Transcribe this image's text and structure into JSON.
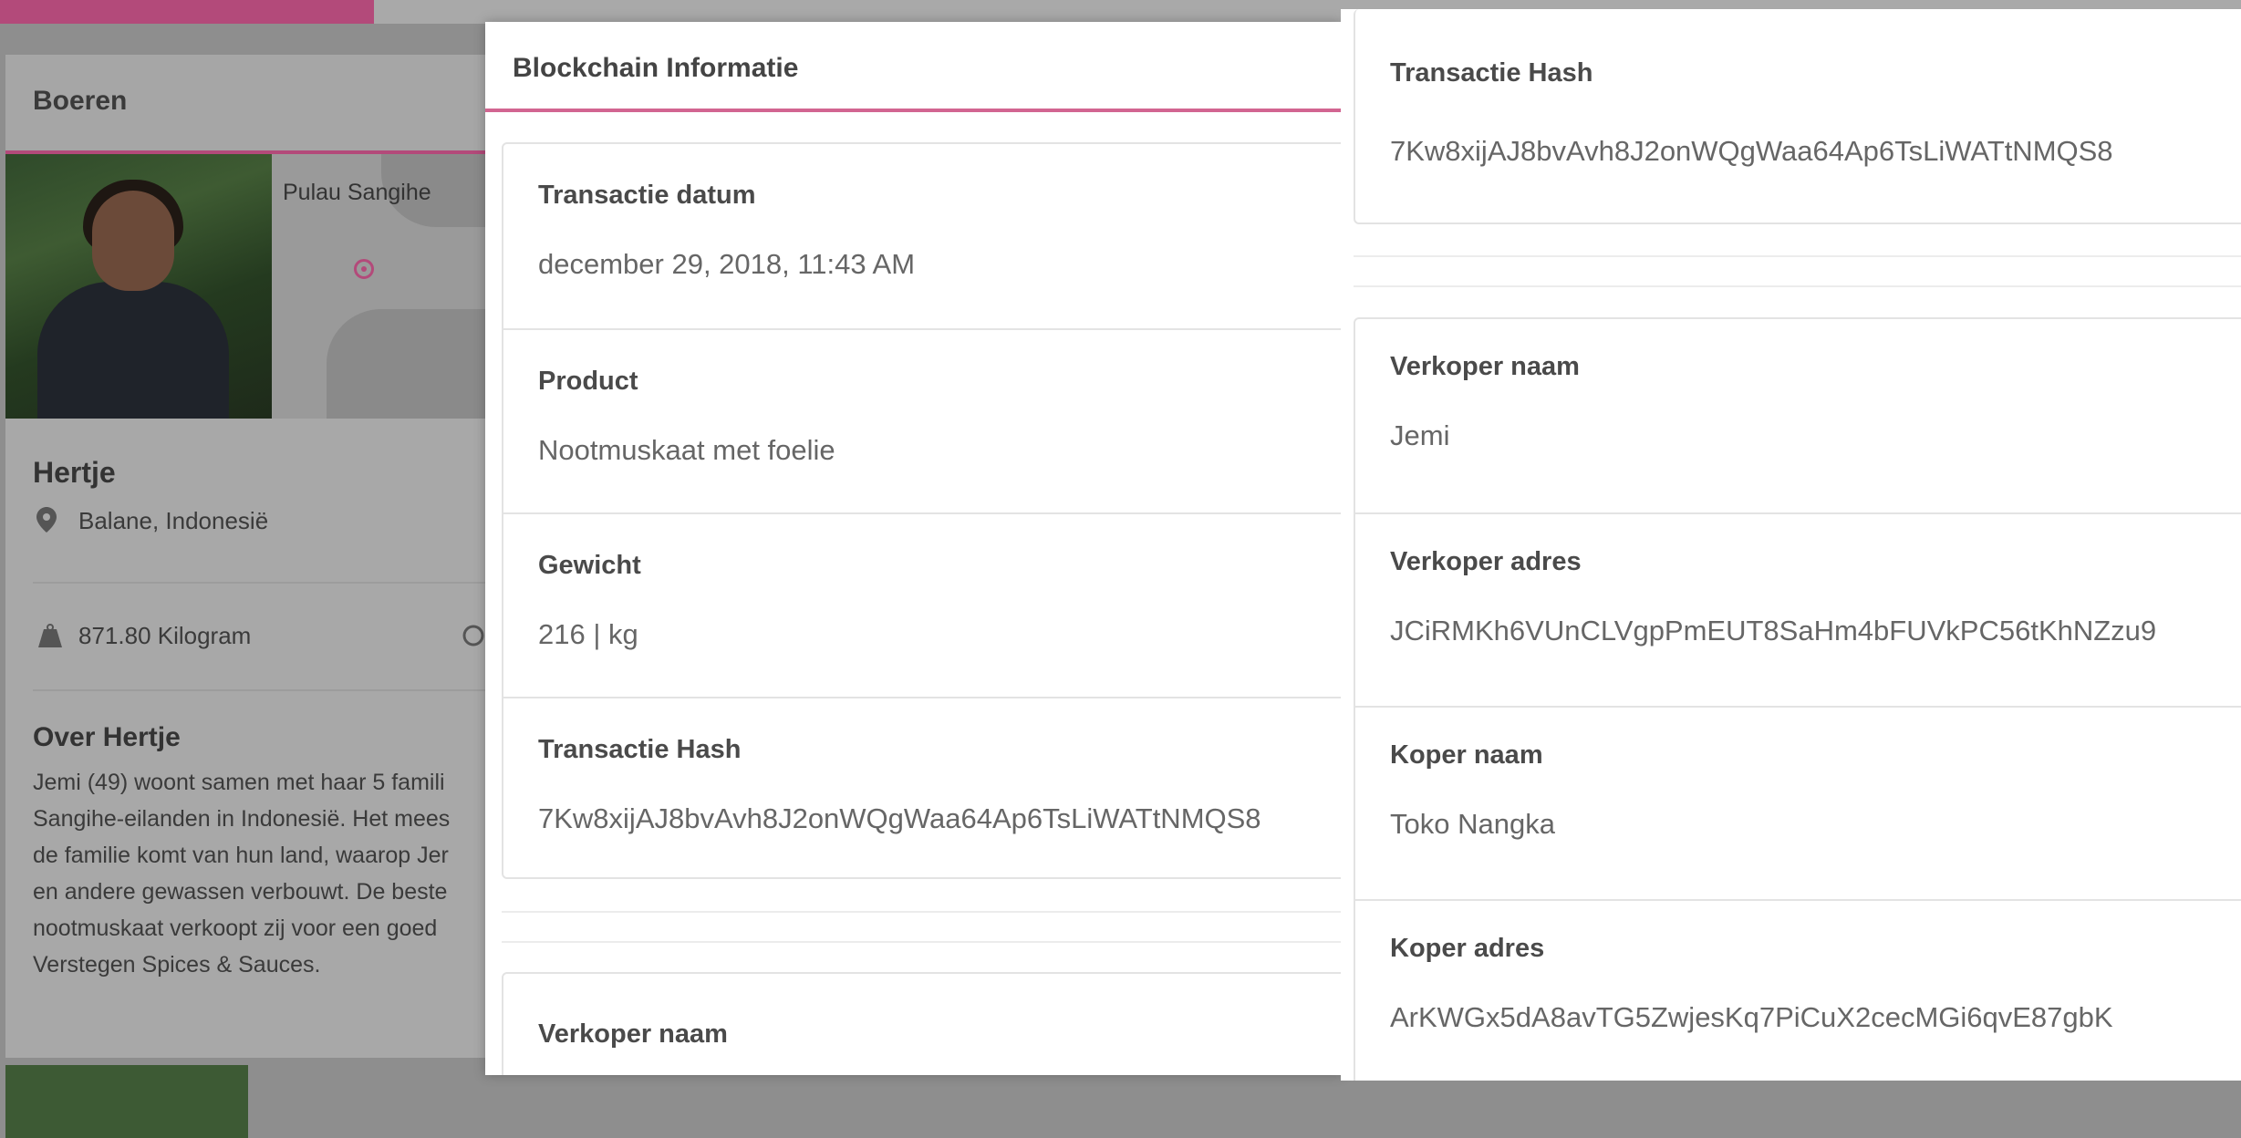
{
  "background": {
    "section_title": "Boeren",
    "map_label": "Pulau Sangihe",
    "farmer_name": "Hertje",
    "location": "Balane, Indonesië",
    "weight": "871.80 Kilogram",
    "about_title": "Over Hertje",
    "about_text": "Jemi (49) woont samen met haar 5 famili\nSangihe-eilanden in Indonesië. Het mees\nde familie komt van hun land, waarop Jer\nen andere gewassen verbouwt. De beste\nnootmuskaat verkoopt zij voor een goed\nVerstegen Spices & Sauces."
  },
  "modal": {
    "title": "Blockchain Informatie",
    "left_fields": [
      {
        "label": "Transactie datum",
        "value": "december 29, 2018, 11:43  AM"
      },
      {
        "label": "Product",
        "value": "Nootmuskaat met foelie"
      },
      {
        "label": "Gewicht",
        "value": "216 | kg"
      },
      {
        "label": "Transactie Hash",
        "value": "7Kw8xijAJ8bvAvh8J2onWQgWaa64Ap6TsLiWATtNMQS8"
      }
    ],
    "left_next_label": "Verkoper naam",
    "right_top": {
      "label": "Transactie Hash",
      "value": "7Kw8xijAJ8bvAvh8J2onWQgWaa64Ap6TsLiWATtNMQS8"
    },
    "right_fields": [
      {
        "label": "Verkoper naam",
        "value": "Jemi"
      },
      {
        "label": "Verkoper adres",
        "value": "JCiRMKh6VUnCLVgpPmEUT8SaHm4bFUVkPC56tKhNZzu9"
      },
      {
        "label": "Koper naam",
        "value": "Toko Nangka"
      },
      {
        "label": "Koper adres",
        "value": "ArKWGx5dA8avTG5ZwjesKq7PiCuX2cecMGi6qvE87gbK"
      }
    ]
  },
  "colors": {
    "accent": "#d26591",
    "accent_dim": "#b34a7a"
  }
}
